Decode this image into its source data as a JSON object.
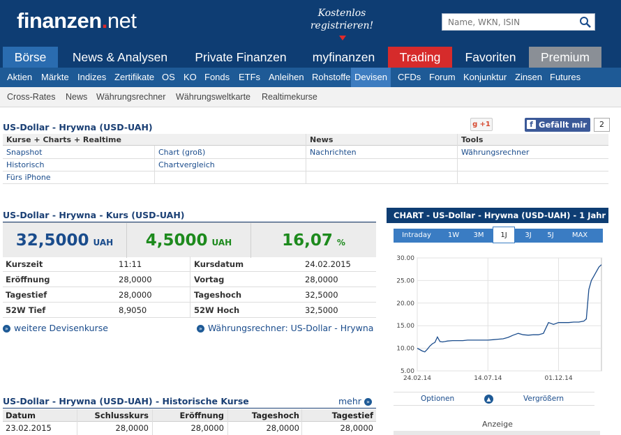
{
  "header": {
    "logo_main": "finanzen",
    "logo_dot": ".",
    "logo_tld": "net",
    "promo_line1": "Kostenlos",
    "promo_line2": "registrieren!",
    "search_placeholder": "Name, WKN, ISIN"
  },
  "main_nav": [
    {
      "label": "Börse",
      "active": true
    },
    {
      "label": "News & Analysen"
    },
    {
      "label": "Private Finanzen"
    },
    {
      "label": "myfinanzen"
    },
    {
      "label": "Trading"
    },
    {
      "label": "Favoriten"
    },
    {
      "label": "Premium"
    }
  ],
  "sub_nav": [
    "Aktien",
    "Märkte",
    "Indizes",
    "Zertifikate",
    "OS",
    "KO",
    "Fonds",
    "ETFs",
    "Anleihen",
    "Rohstoffe",
    "Devisen",
    "CFDs",
    "Forum",
    "Konjunktur",
    "Zinsen",
    "Futures"
  ],
  "third_nav": [
    "Cross-Rates",
    "News",
    "Währungsrechner",
    "Währungsweltkarte",
    "Realtimekurse"
  ],
  "links_section": {
    "title": "US-Dollar - Hrywna (USD-UAH)",
    "gplus": "+1",
    "fb_like": "Gefällt mir",
    "fb_count": "2",
    "headers": [
      "Kurse + Charts + Realtime",
      "News",
      "Tools"
    ],
    "col1": [
      "Snapshot",
      "Historisch",
      "Fürs iPhone"
    ],
    "col2": [
      "Chart (groß)",
      "Chartvergleich"
    ],
    "col3": [
      "Nachrichten"
    ],
    "col4": [
      "Währungsrechner"
    ]
  },
  "quote_section": {
    "title": "US-Dollar - Hrywna - Kurs (USD-UAH)",
    "price": "32,5000",
    "price_unit": "UAH",
    "change": "4,5000",
    "change_unit": "UAH",
    "change_pct": "16,07",
    "pct_unit": "%",
    "rows": [
      {
        "l1": "Kurszeit",
        "v1": "11:11",
        "l2": "Kursdatum",
        "v2": "24.02.2015"
      },
      {
        "l1": "Eröffnung",
        "v1": "28,0000",
        "l2": "Vortag",
        "v2": "28,0000"
      },
      {
        "l1": "Tagestief",
        "v1": "28,0000",
        "l2": "Tageshoch",
        "v2": "32,5000"
      },
      {
        "l1": "52W Tief",
        "v1": "8,9050",
        "l2": "52W Hoch",
        "v2": "32,5000"
      }
    ],
    "link_more": "weitere Devisenkurse",
    "link_calc": "Währungsrechner: US-Dollar - Hrywna"
  },
  "chart": {
    "title": "CHART - US-Dollar - Hrywna (USD-UAH) - 1 Jahr",
    "ranges": [
      "Intraday",
      "1W",
      "3M",
      "1J",
      "3J",
      "5J",
      "MAX"
    ],
    "selected_range": "1J",
    "options_label": "Optionen",
    "enlarge_label": "Vergrößern",
    "ad_label": "Anzeige"
  },
  "chart_data": {
    "type": "line",
    "title": "CHART - US-Dollar - Hrywna (USD-UAH) - 1 Jahr",
    "xlabel": "",
    "ylabel": "",
    "ylim": [
      5,
      30
    ],
    "yticks": [
      "30.00",
      "25.00",
      "20.00",
      "15.00",
      "10.00",
      "5.00"
    ],
    "xticks": [
      "24.02.14",
      "14.07.14",
      "01.12.14"
    ],
    "grid": true,
    "series": [
      {
        "x": [
          0,
          5,
          10,
          15,
          20,
          25,
          30,
          35,
          40,
          45,
          50,
          55,
          60,
          70,
          80,
          90,
          100,
          110,
          120,
          130,
          140,
          150,
          160,
          170,
          180,
          190,
          200,
          210,
          220,
          230,
          240,
          250,
          260,
          270,
          280,
          290,
          300,
          310,
          320,
          330,
          335,
          340,
          345,
          350,
          355,
          360,
          365
        ],
        "values": [
          10.0,
          9.7,
          9.4,
          9.2,
          9.8,
          10.5,
          11.0,
          11.3,
          12.5,
          11.5,
          11.4,
          11.5,
          11.6,
          11.7,
          11.7,
          11.7,
          11.8,
          11.8,
          11.8,
          11.8,
          11.8,
          11.9,
          12.0,
          12.1,
          12.4,
          12.9,
          13.3,
          13.0,
          12.9,
          13.0,
          13.0,
          13.3,
          15.7,
          15.3,
          15.7,
          15.7,
          15.7,
          15.8,
          15.8,
          16.0,
          16.5,
          23.0,
          25.0,
          26.0,
          27.0,
          28.0,
          28.5
        ]
      }
    ]
  },
  "history": {
    "title": "US-Dollar - Hrywna (USD-UAH) - Historische Kurse",
    "more": "mehr",
    "headers": [
      "Datum",
      "Schlusskurs",
      "Eröffnung",
      "Tageshoch",
      "Tagestief"
    ],
    "rows": [
      [
        "23.02.2015",
        "28,0000",
        "28,0000",
        "28,0000",
        "28,0000"
      ]
    ]
  },
  "colors": {
    "header_bg": "#0e3d73",
    "subnav_bg": "#1e5a96",
    "trading_red": "#d62b2b",
    "premium_gray": "#8a8f96",
    "price_blue": "#1a4c8c",
    "change_green": "#1d8a1d"
  }
}
